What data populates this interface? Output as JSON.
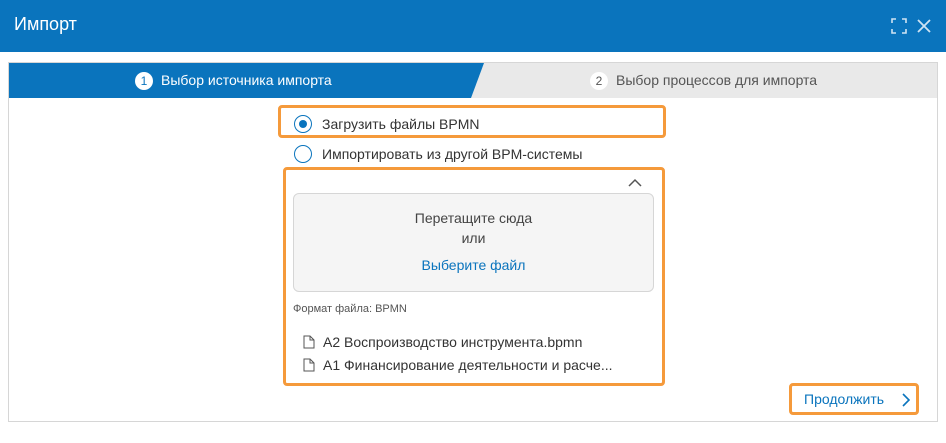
{
  "window": {
    "title": "Импорт"
  },
  "steps": [
    {
      "number": "1",
      "label": "Выбор источника импорта",
      "active": true
    },
    {
      "number": "2",
      "label": "Выбор процессов для импорта",
      "active": false
    }
  ],
  "source_options": [
    {
      "label": "Загрузить файлы BPMN",
      "checked": true
    },
    {
      "label": "Импортировать из другой BPM-системы",
      "checked": false
    }
  ],
  "dropzone": {
    "line1": "Перетащите сюда",
    "line2": "или",
    "link": "Выберите файл"
  },
  "format_text": "Формат файла: BPMN",
  "files": [
    "A2 Воспроизводство инструмента.bpmn",
    "A1 Финансирование деятельности и расче..."
  ],
  "footer": {
    "continue_label": "Продолжить"
  },
  "colors": {
    "accent": "#0a74bd",
    "highlight": "#f59a3b"
  }
}
